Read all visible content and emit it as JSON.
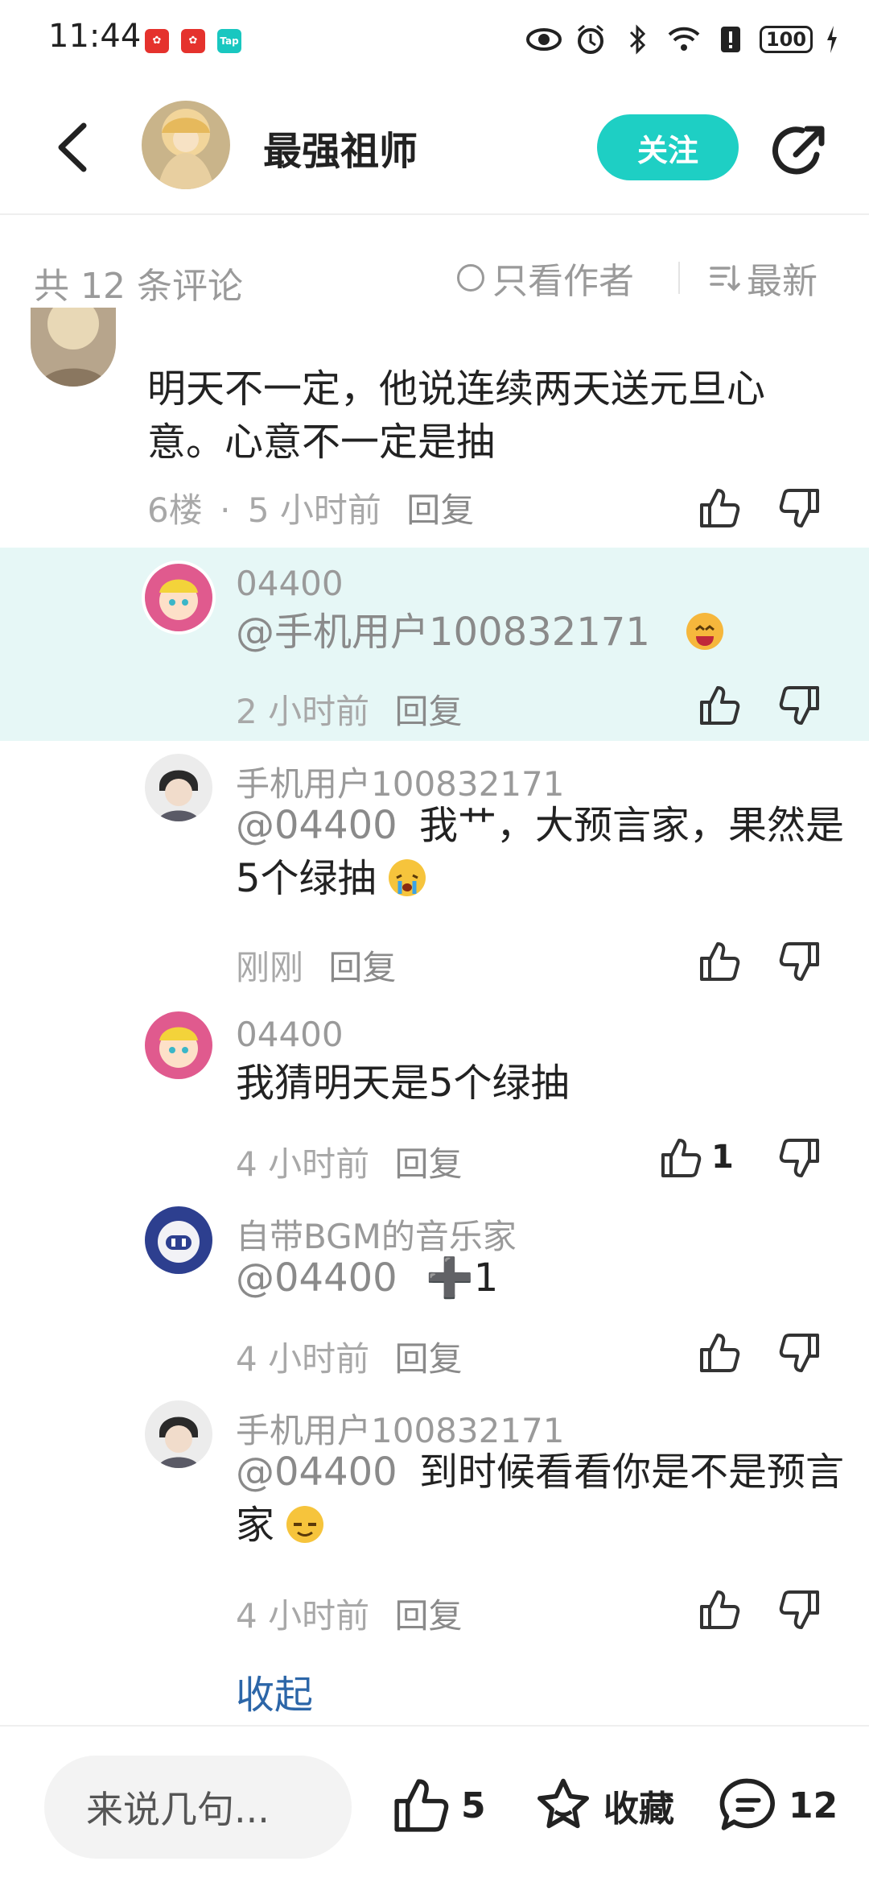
{
  "status_bar": {
    "time": "11:44",
    "app_icons": [
      "huawei-icon",
      "huawei-icon",
      "taptap-icon"
    ],
    "taptap_label": "Tap",
    "battery": "100"
  },
  "header": {
    "title": "最强祖师",
    "follow_label": "关注"
  },
  "comment_bar": {
    "count_text": "共 12 条评论",
    "author_only_label": "只看作者",
    "sort_label": "最新"
  },
  "comments": [
    {
      "text": "明天不一定，他说连续两天送元旦心意。心意不一定是抽",
      "floor": "6楼",
      "separator": "·",
      "time": "5 小时前",
      "reply": "回复"
    },
    {
      "name": "04400",
      "mention": "@手机用户100832171",
      "text": "",
      "time": "2 小时前",
      "reply": "回复",
      "highlighted": true
    },
    {
      "name": "手机用户100832171",
      "mention": "@04400",
      "text": "我艹，大预言家，果然是5个绿抽",
      "time": "刚刚",
      "reply": "回复"
    },
    {
      "name": "04400",
      "mention": "",
      "text": "我猜明天是5个绿抽",
      "time": "4 小时前",
      "reply": "回复",
      "like_count": "1"
    },
    {
      "name": "自带BGM的音乐家",
      "mention": "@04400",
      "text": "➕1",
      "time": "4 小时前",
      "reply": "回复"
    },
    {
      "name": "手机用户100832171",
      "mention": "@04400",
      "text": "到时候看看你是不是预言家",
      "time": "4 小时前",
      "reply": "回复"
    }
  ],
  "collapse_label": "收起",
  "bottom_bar": {
    "input_placeholder": "来说几句...",
    "like_count": "5",
    "favorite_label": "收藏",
    "comment_count": "12"
  },
  "colors": {
    "accent": "#1ecfc4",
    "highlight_bg": "#e6f7f6",
    "link": "#2c66a8"
  }
}
